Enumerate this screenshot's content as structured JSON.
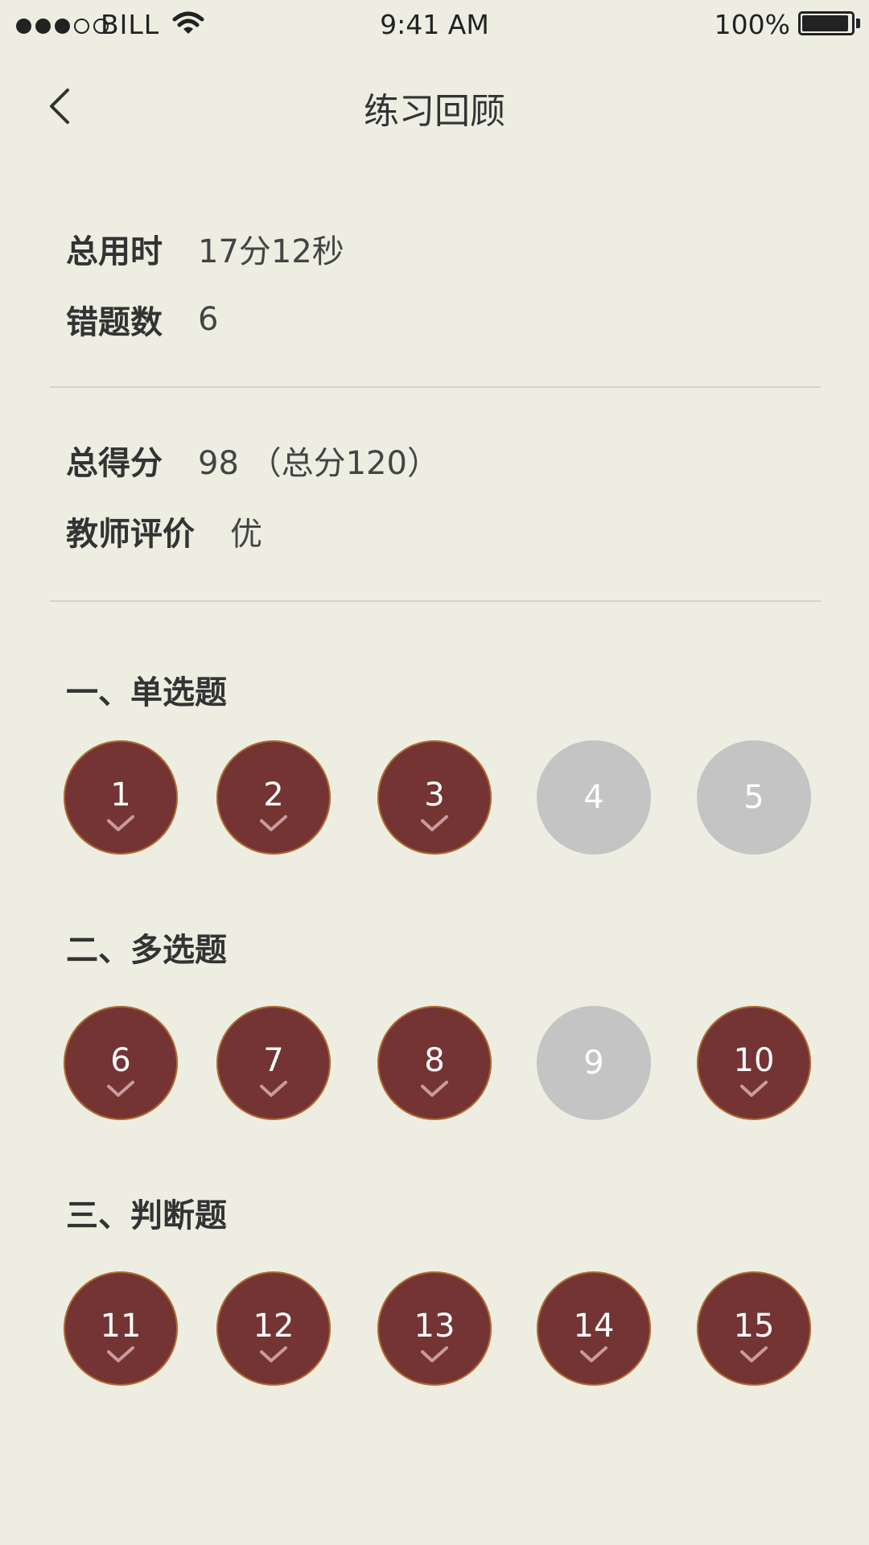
{
  "status_bar": {
    "carrier": "BILL",
    "time": "9:41 AM",
    "battery_percent": "100%",
    "battery_level": 0.95
  },
  "nav": {
    "title": "练习回顾",
    "back_icon": "chevron-left-icon"
  },
  "summary": {
    "total_time_label": "总用时",
    "total_time_value": "17分12秒",
    "wrong_count_label": "错题数",
    "wrong_count_value": "6",
    "total_score_label": "总得分",
    "total_score_value": "98 （总分120）",
    "teacher_eval_label": "教师评价",
    "teacher_eval_value": "优"
  },
  "colors": {
    "background": "#EDEDE2",
    "answered": "#743434",
    "unanswered": "#C4C4C4",
    "check": "#C99A9E"
  },
  "sections": [
    {
      "title": "一、单选题",
      "questions": [
        {
          "num": "1",
          "answered": true
        },
        {
          "num": "2",
          "answered": true
        },
        {
          "num": "3",
          "answered": true
        },
        {
          "num": "4",
          "answered": false
        },
        {
          "num": "5",
          "answered": false
        }
      ]
    },
    {
      "title": "二、多选题",
      "questions": [
        {
          "num": "6",
          "answered": true
        },
        {
          "num": "7",
          "answered": true
        },
        {
          "num": "8",
          "answered": true
        },
        {
          "num": "9",
          "answered": false
        },
        {
          "num": "10",
          "answered": true
        }
      ]
    },
    {
      "title": "三、判断题",
      "questions": [
        {
          "num": "11",
          "answered": true
        },
        {
          "num": "12",
          "answered": true
        },
        {
          "num": "13",
          "answered": true
        },
        {
          "num": "14",
          "answered": true
        },
        {
          "num": "15",
          "answered": true
        }
      ]
    }
  ]
}
